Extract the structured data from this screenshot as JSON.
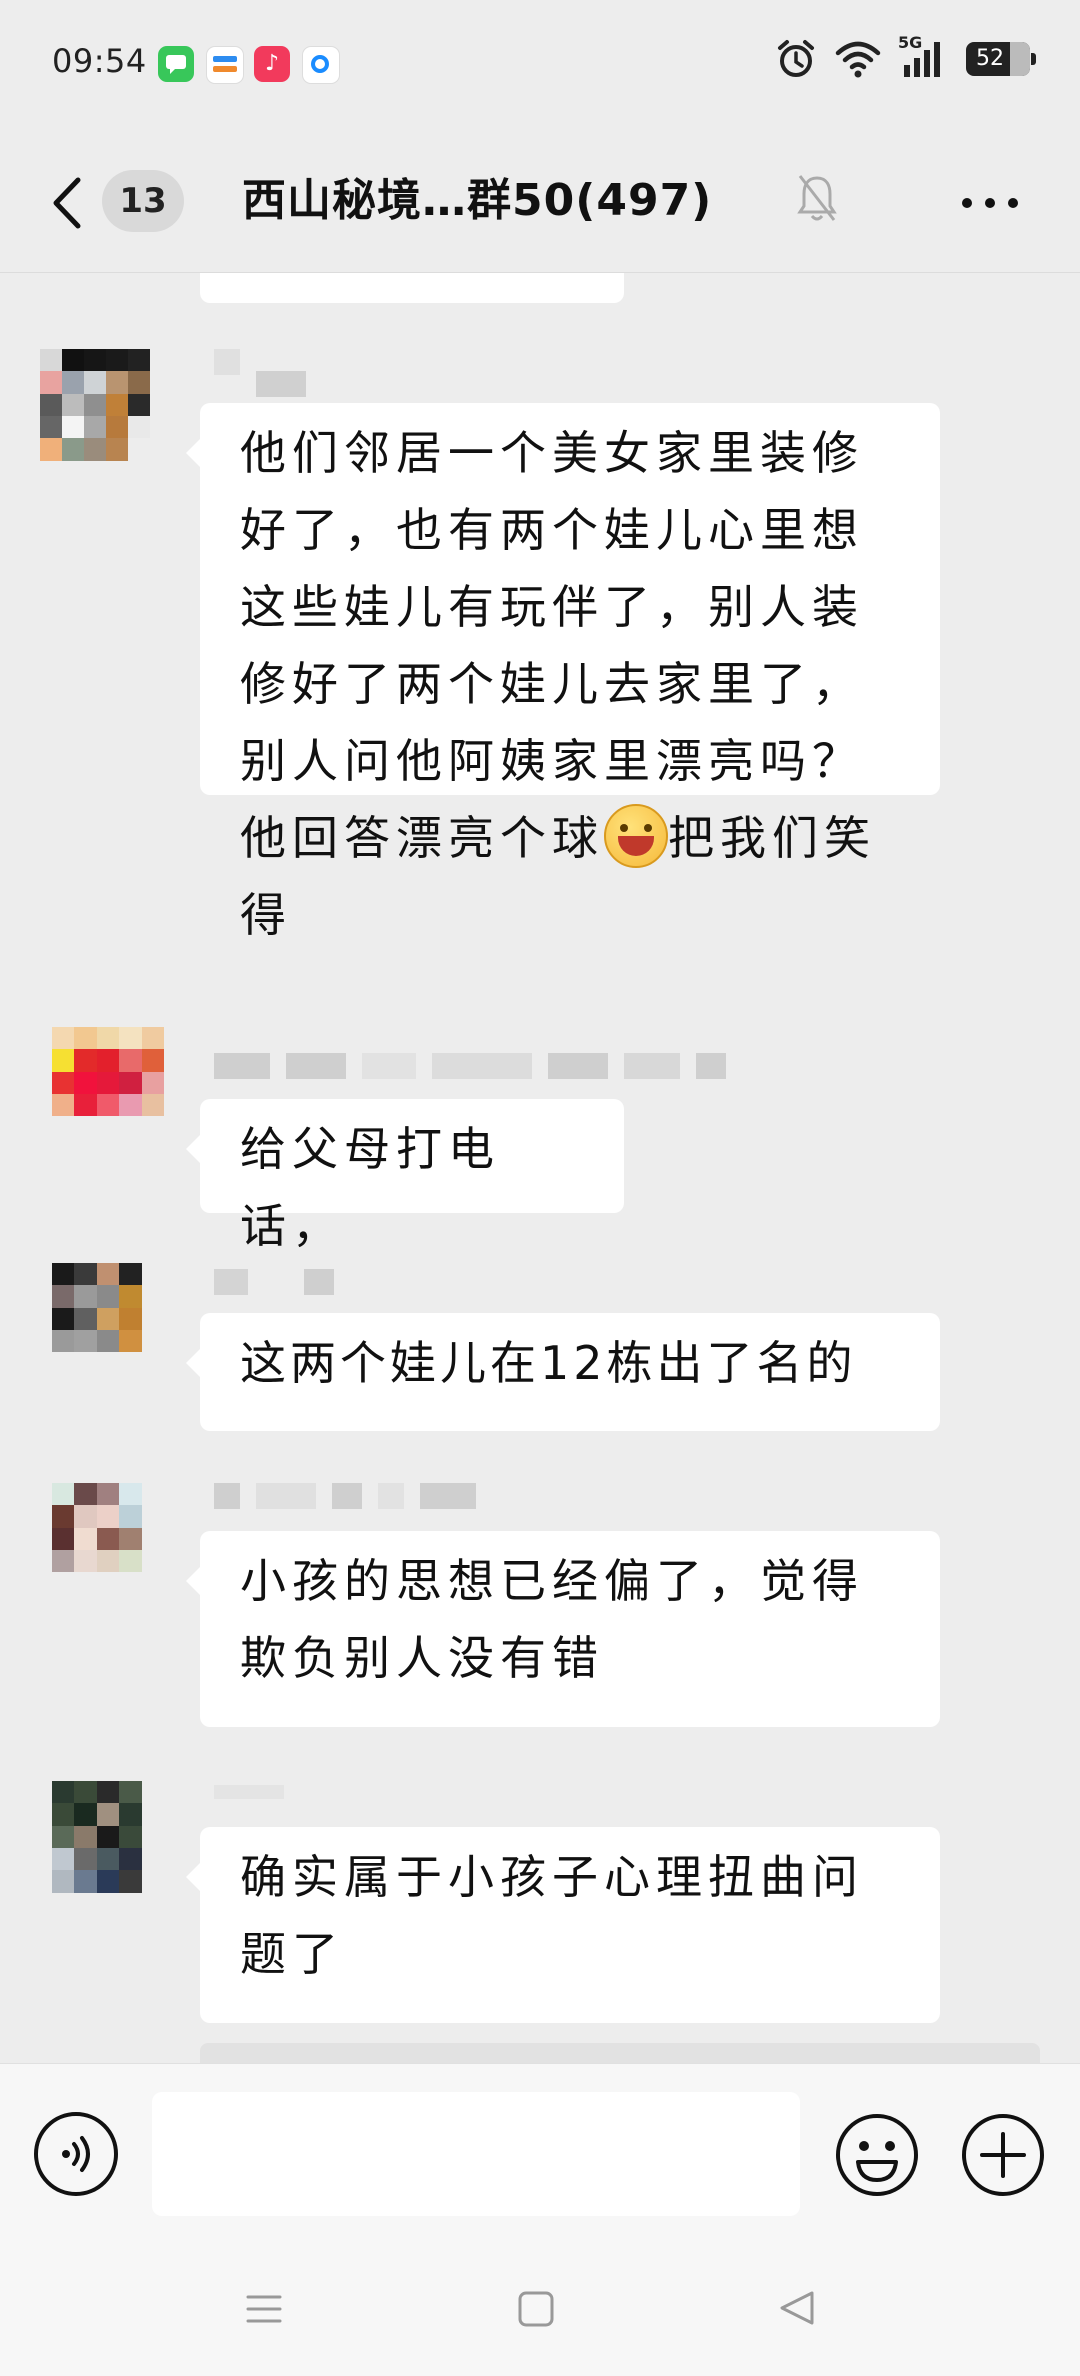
{
  "status_bar": {
    "time": "09:54",
    "network": "5G",
    "battery": "52",
    "notification_icons": [
      "messages-app-icon",
      "wallet-app-icon",
      "music-app-icon",
      "browser-app-icon"
    ],
    "system_icons": [
      "alarm-icon",
      "wifi-icon",
      "signal-icon"
    ]
  },
  "header": {
    "unread_count": "13",
    "title": "西山秘境…群50(497)",
    "icons": [
      "back-chevron-icon",
      "mute-bell-icon",
      "more-dots-icon"
    ]
  },
  "messages": [
    {
      "lines": [
        "他们邻居一个美女家里装修",
        "好了，也有两个娃儿心里想",
        "这些娃儿有玩伴了，别人装",
        "修好了两个娃儿去家里了，",
        "别人问他阿姨家里漂亮吗？"
      ],
      "line6_before": "他回答漂亮个球",
      "emoji": "grinning-face-emoji",
      "line6_after": "把我们笑",
      "line7": "得"
    },
    {
      "text": "给父母打电话，"
    },
    {
      "text": "这两个娃儿在12栋出了名的"
    },
    {
      "lines": [
        "小孩的思想已经偏了，觉得",
        "欺负别人没有错"
      ]
    },
    {
      "lines": [
        "确实属于小孩子心理扭曲问",
        "题了"
      ]
    }
  ],
  "input_bar": {
    "placeholder": "",
    "icons": [
      "voice-icon",
      "emoji-icon",
      "plus-icon"
    ]
  },
  "nav_bar": {
    "icons": [
      "menu-lines-icon",
      "home-square-icon",
      "back-triangle-icon"
    ]
  },
  "colors": {
    "background": "#ededed",
    "bubble": "#ffffff",
    "bar": "#f7f7f7"
  }
}
